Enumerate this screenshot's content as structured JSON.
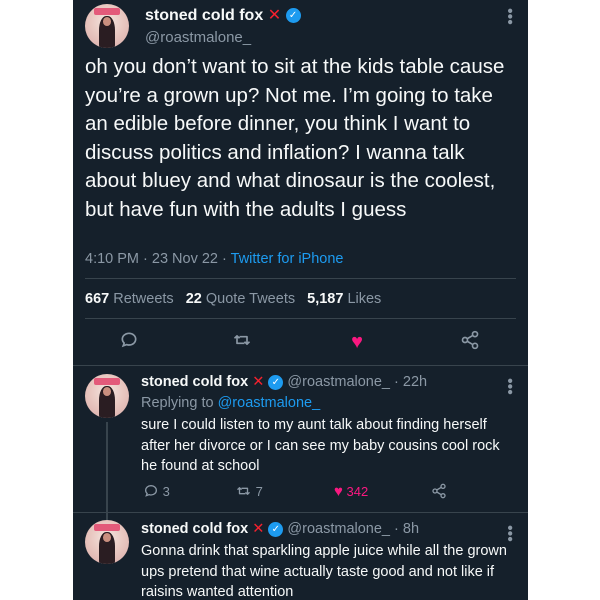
{
  "main_tweet": {
    "display_name": "stoned cold fox",
    "handle": "@roastmalone_",
    "text": "oh you don’t want to sit at the kids table cause you’re a grown up? Not me. I’m going to take an edible before dinner, you think I want to discuss politics and inflation? I wanna talk about bluey and what dinosaur is the coolest, but have fun with the adults I guess",
    "time": "4:10 PM",
    "date": "23 Nov 22",
    "source": "Twitter for iPhone",
    "retweets": "667",
    "retweets_label": "Retweets",
    "quote_tweets": "22",
    "quote_tweets_label": "Quote Tweets",
    "likes": "5,187",
    "likes_label": "Likes"
  },
  "replies": [
    {
      "display_name": "stoned cold fox",
      "handle": "@roastmalone_",
      "age": "22h",
      "replying_to_label": "Replying to",
      "replying_to": "@roastmalone_",
      "text": "sure I could listen to my aunt talk about finding herself after her divorce or I can see my baby cousins cool rock he found at school",
      "reply_count": "3",
      "retweet_count": "7",
      "like_count": "342"
    },
    {
      "display_name": "stoned cold fox",
      "handle": "@roastmalone_",
      "age": "8h",
      "text": "Gonna drink that sparkling apple juice while all the grown ups pretend that wine actually taste good and not like if raisins wanted attention"
    }
  ],
  "icons": {
    "x_mark": "✕",
    "verified": "✓",
    "more": "•••",
    "retweet": "⇄",
    "heart": "♥",
    "share": "share-icon"
  },
  "colors": {
    "background": "#15202b",
    "accent": "#1d9bf0",
    "like": "#f91880",
    "x_mark": "#f4212e"
  }
}
